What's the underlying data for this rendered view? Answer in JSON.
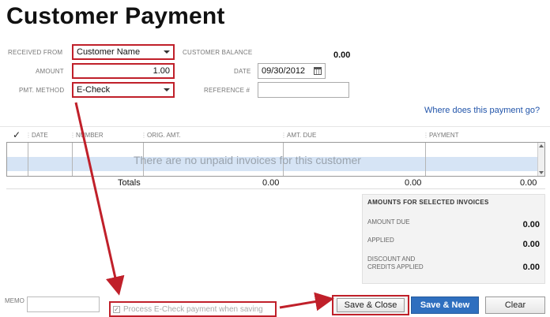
{
  "title": "Customer Payment",
  "form": {
    "received_from_label": "RECEIVED FROM",
    "received_from_value": "Customer Name",
    "customer_balance_label": "CUSTOMER BALANCE",
    "customer_balance_value": "0.00",
    "amount_label": "AMOUNT",
    "amount_value": "1.00",
    "date_label": "DATE",
    "date_value": "09/30/2012",
    "pmt_method_label": "PMT. METHOD",
    "pmt_method_value": "E-Check",
    "reference_label": "REFERENCE #",
    "reference_value": "",
    "help_link": "Where does this payment go?"
  },
  "grid": {
    "columns": [
      "DATE",
      "NUMBER",
      "ORIG. AMT.",
      "AMT. DUE",
      "PAYMENT"
    ],
    "empty_message": "There are no unpaid invoices for this customer",
    "totals_label": "Totals",
    "totals": [
      "0.00",
      "0.00",
      "0.00"
    ]
  },
  "amounts_panel": {
    "header": "AMOUNTS FOR SELECTED INVOICES",
    "amount_due_label": "AMOUNT DUE",
    "amount_due_value": "0.00",
    "applied_label": "APPLIED",
    "applied_value": "0.00",
    "discount_label_1": "DISCOUNT AND",
    "discount_label_2": "CREDITS APPLIED",
    "discount_value": "0.00"
  },
  "footer": {
    "memo_label": "MEMO",
    "echeck_label": "Process E-Check payment when saving",
    "save_close": "Save & Close",
    "save_new": "Save & New",
    "clear": "Clear"
  },
  "colors": {
    "annotation_red": "#c0202a",
    "primary_button": "#2f6fbf",
    "link": "#2255aa"
  }
}
